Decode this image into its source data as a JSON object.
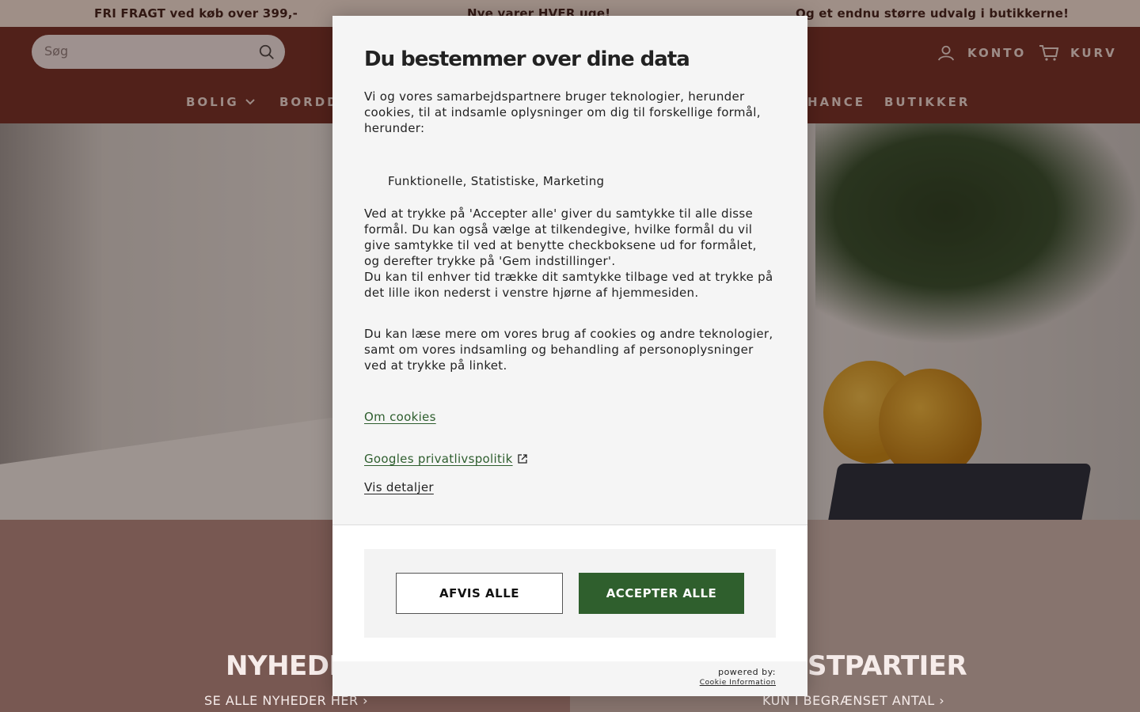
{
  "announcement": {
    "msg1": "FRI FRAGT ved køb over 399,-",
    "msg2": "Nye varer HVER uge!",
    "msg3": "Og et endnu større udvalg i butikkerne!"
  },
  "header": {
    "search_label": "Søg",
    "account_label": "KONTO",
    "cart_label": "KURV"
  },
  "nav": {
    "items": [
      "BOLIG",
      "BORDDA",
      "HANCE",
      "BUTIKKER"
    ]
  },
  "sections": {
    "left_title": "NYHEDER",
    "left_link": "SE ALLE NYHEDER HER ›",
    "right_title": "STPARTIER",
    "right_link": "KUN I BEGRÆNSET ANTAL ›"
  },
  "consent": {
    "title": "Du bestemmer over dine data",
    "intro": "Vi og vores samarbejdspartnere bruger teknologier, herunder cookies, til at indsamle oplysninger om dig til forskellige formål, herunder:",
    "purposes": "Funktionelle, Statistiske, Marketing",
    "para_accept": "Ved at trykke på 'Accepter alle' giver du samtykke til alle disse formål. Du kan også vælge at tilkendegive, hvilke formål du vil give samtykke til ved at benytte checkboksene ud for formålet, og derefter trykke på 'Gem indstillinger'.",
    "para_withdraw": "Du kan til enhver tid trække dit samtykke tilbage ved at trykke på det lille ikon nederst i venstre hjørne af hjemmesiden.",
    "para_more": "Du kan læse mere om vores brug af cookies og andre teknologier, samt om vores indsamling og behandling af personoplysninger ved at trykke på linket.",
    "link_cookies": "Om cookies",
    "link_google": "Googles privatlivspolitik",
    "link_details": "Vis detaljer",
    "btn_reject": "AFVIS ALLE",
    "btn_accept": "ACCEPTER ALLE",
    "powered_by": "powered by:",
    "brand": "Cookie Information"
  },
  "colors": {
    "accept_green": "#2f5f2d",
    "header_brown": "#6e2c24",
    "link_green": "#2e5e2e"
  }
}
